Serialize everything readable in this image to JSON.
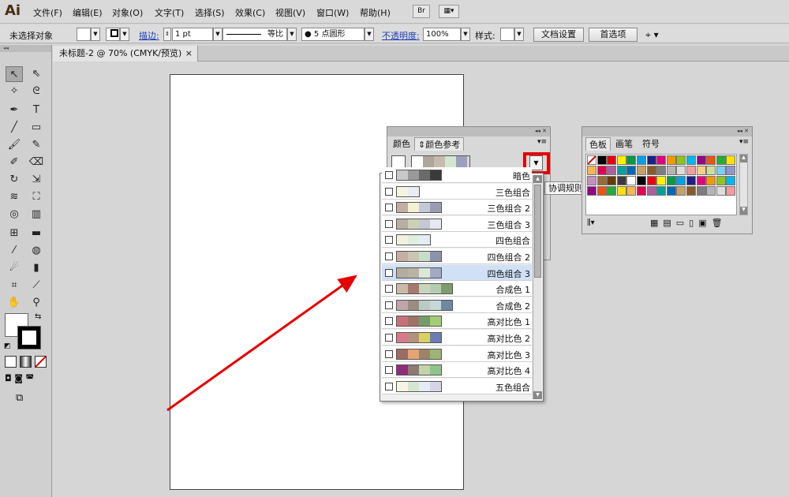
{
  "menubar": {
    "app_logo": "Ai",
    "items": [
      "文件(F)",
      "编辑(E)",
      "对象(O)",
      "文字(T)",
      "选择(S)",
      "效果(C)",
      "视图(V)",
      "窗口(W)",
      "帮助(H)"
    ],
    "bridge_label": "Br"
  },
  "control_bar": {
    "selection_status": "未选择对象",
    "stroke_label": "描边:",
    "stroke_weight": "1 pt",
    "stroke_profile": "等比",
    "brush": "● 5 点圆形",
    "opacity_label": "不透明度:",
    "opacity_value": "100%",
    "style_label": "样式:",
    "doc_setup_button": "文档设置",
    "preferences_button": "首选项"
  },
  "document": {
    "tab_title": "未标题-2 @ 70% (CMYK/预览)",
    "close_glyph": "×"
  },
  "color_guide_panel": {
    "tabs": [
      "颜色",
      "颜色参考"
    ],
    "tooltip": "协调规则",
    "harmony_rules": [
      {
        "name": "暗色",
        "colors": [
          "#c8c8c8",
          "#9a9a9a",
          "#6b6b6b",
          "#3a3a3a"
        ]
      },
      {
        "name": "三色组合",
        "colors": [
          "#f6f3e0",
          "#e8ecf4"
        ]
      },
      {
        "name": "三色组合 2",
        "colors": [
          "#c2aea2",
          "#f4f0d2",
          "#c4c9d8",
          "#9a9cb2"
        ]
      },
      {
        "name": "三色组合 3",
        "colors": [
          "#b7aea4",
          "#cdd0b6",
          "#c6c7d4",
          "#e6e9f3"
        ]
      },
      {
        "name": "四色组合",
        "colors": [
          "#f3f0e0",
          "#dfeedd",
          "#e6ecf6"
        ]
      },
      {
        "name": "四色组合 2",
        "colors": [
          "#c2aea2",
          "#c9c4b3",
          "#c6dec8",
          "#8b93ac"
        ]
      },
      {
        "name": "四色组合 3",
        "colors": [
          "#b4aca0",
          "#b9b3a4",
          "#dbe9d6",
          "#a3aac4"
        ]
      },
      {
        "name": "合成色 1",
        "colors": [
          "#ccbaa8",
          "#a67a6e",
          "#c7d5be",
          "#b6ccb0",
          "#7e9c6c"
        ]
      },
      {
        "name": "合成色 2",
        "colors": [
          "#c0a6a8",
          "#9c8c80",
          "#bccac6",
          "#c6d8d6",
          "#6e8aa0"
        ]
      },
      {
        "name": "高对比色 1",
        "colors": [
          "#c8707a",
          "#a07266",
          "#749c6a",
          "#a3cd74"
        ]
      },
      {
        "name": "高对比色 2",
        "colors": [
          "#d87a88",
          "#b2927c",
          "#d8d062",
          "#6c7cb4"
        ]
      },
      {
        "name": "高对比色 3",
        "colors": [
          "#9c6c62",
          "#e4a474",
          "#9c8466",
          "#9cb476"
        ]
      },
      {
        "name": "高对比色 4",
        "colors": [
          "#8e2e78",
          "#8e7a72",
          "#c2d4a8",
          "#8ec48a"
        ]
      },
      {
        "name": "五色组合",
        "colors": [
          "#f6f4e6",
          "#d4e6d0",
          "#e6ecf6",
          "#d6d4e6"
        ]
      }
    ]
  },
  "swatches_panel": {
    "tabs": [
      "色板",
      "画笔",
      "符号"
    ],
    "colors": [
      "#ffffff",
      "#000000",
      "#e60012",
      "#fff100",
      "#009944",
      "#00a0e9",
      "#1d2088",
      "#e4007f",
      "#f39800",
      "#8fc31f",
      "#00b7ee",
      "#920783",
      "#ea5514",
      "#22ac38",
      "#ffe100",
      "#f8b551",
      "#e5004f",
      "#ae5da1",
      "#00a29a",
      "#0068b7",
      "#c9a063",
      "#8b5a2b",
      "#7d7d7d",
      "#b5b5b5",
      "#dcdcdc",
      "#f29c9f",
      "#facd89",
      "#cce198",
      "#7ecef4",
      "#8c97cb",
      "#c490bf",
      "#996c33",
      "#6a3906",
      "#3e3a39"
    ]
  },
  "colors": {
    "menubar_bg": "#d9d9d9",
    "highlight_row": "#cfe0f7",
    "annotation_red": "#e60000"
  }
}
